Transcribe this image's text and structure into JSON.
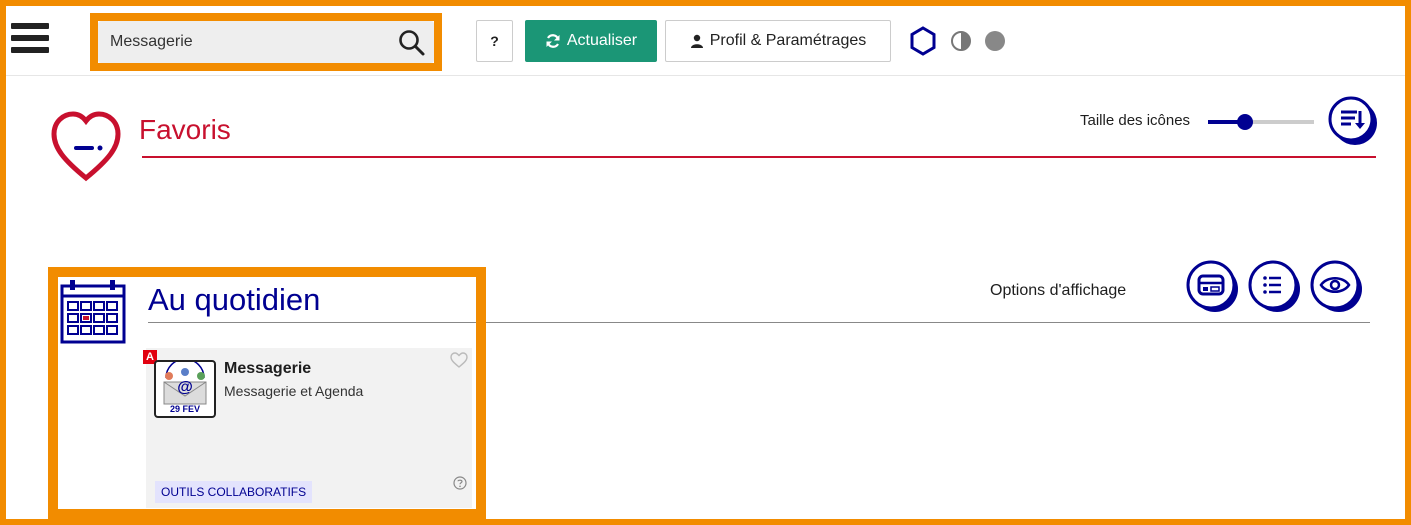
{
  "search": {
    "value": "Messagerie"
  },
  "toolbar": {
    "help_label": "?",
    "refresh_label": "Actualiser",
    "profile_label": "Profil & Paramétrages"
  },
  "favoris": {
    "title": "Favoris",
    "icon_size_label": "Taille des icônes",
    "icon_size_level": 0.35
  },
  "section": {
    "title": "Au quotidien",
    "display_options_label": "Options d'affichage"
  },
  "card": {
    "badge": "A",
    "title": "Messagerie",
    "description": "Messagerie et Agenda",
    "icon_date": "29 FEV",
    "tag": "OUTILS COLLABORATIFS"
  },
  "colors": {
    "highlight": "#f28c00",
    "primary_blue": "#000091",
    "accent_red": "#c8102e",
    "refresh_green": "#1b9676"
  },
  "icons": [
    "menu-icon",
    "search-icon",
    "refresh-icon",
    "user-icon",
    "brightness-icon",
    "contrast-icon",
    "dark-mode-icon",
    "heart-icon",
    "sort-icon",
    "calendar-icon",
    "card-view-icon",
    "list-view-icon",
    "eye-icon",
    "help-icon"
  ]
}
